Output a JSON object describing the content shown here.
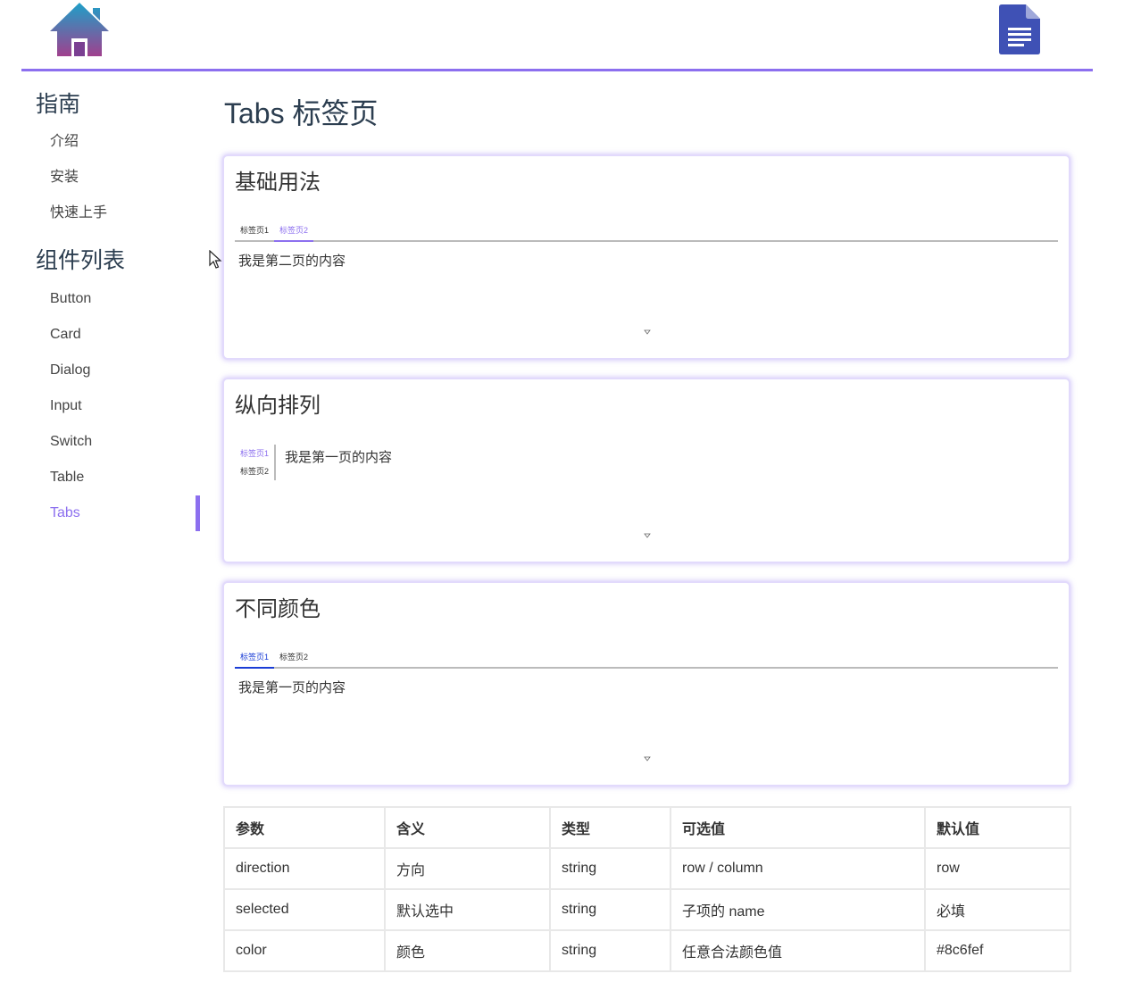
{
  "header": {
    "home_icon": "home-icon",
    "doc_icon": "document-icon",
    "accent": "#8c6fef"
  },
  "sidebar": {
    "groups": [
      {
        "title": "指南",
        "items": [
          "介绍",
          "安装",
          "快速上手"
        ]
      },
      {
        "title": "组件列表",
        "items": [
          "Button",
          "Card",
          "Dialog",
          "Input",
          "Switch",
          "Table",
          "Tabs"
        ]
      }
    ],
    "active_item": "Tabs"
  },
  "page": {
    "title": "Tabs 标签页"
  },
  "cards": [
    {
      "title": "基础用法",
      "tabs": [
        "标签页1",
        "标签页2"
      ],
      "selected": "标签页2",
      "content": "我是第二页的内容",
      "color": "#8c6fef"
    },
    {
      "title": "纵向排列",
      "tabs": [
        "标签页1",
        "标签页2"
      ],
      "selected": "标签页1",
      "content": "我是第一页的内容",
      "direction": "column"
    },
    {
      "title": "不同颜色",
      "tabs": [
        "标签页1",
        "标签页2"
      ],
      "selected": "标签页1",
      "content": "我是第一页的内容",
      "color": "#1a3dd6"
    }
  ],
  "table": {
    "headers": [
      "参数",
      "含义",
      "类型",
      "可选值",
      "默认值"
    ],
    "rows": [
      [
        "direction",
        "方向",
        "string",
        "row / column",
        "row"
      ],
      [
        "selected",
        "默认选中",
        "string",
        "子项的 name",
        "必填"
      ],
      [
        "color",
        "颜色",
        "string",
        "任意合法颜色值",
        "#8c6fef"
      ]
    ]
  }
}
